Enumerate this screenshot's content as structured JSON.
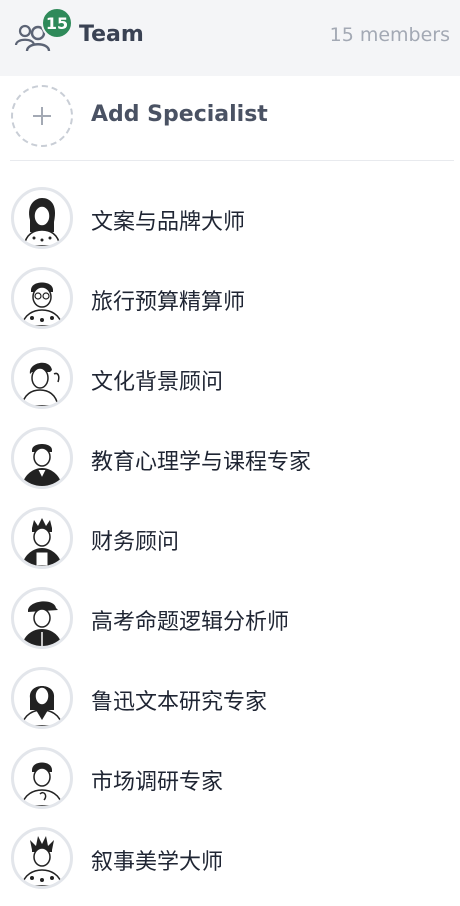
{
  "header": {
    "title": "Team",
    "badge_count": "15",
    "member_count": "15 members",
    "icon": "team-icon"
  },
  "add": {
    "label": "Add Specialist",
    "icon": "plus-icon"
  },
  "specialists": [
    {
      "name": "文案与品牌大师"
    },
    {
      "name": "旅行预算精算师"
    },
    {
      "name": "文化背景顾问"
    },
    {
      "name": "教育心理学与课程专家"
    },
    {
      "name": "财务顾问"
    },
    {
      "name": "高考命题逻辑分析师"
    },
    {
      "name": "鲁迅文本研究专家"
    },
    {
      "name": "市场调研专家"
    },
    {
      "name": "叙事美学大师"
    }
  ],
  "colors": {
    "badge": "#2f8a5a",
    "header_bg": "#f4f5f7",
    "avatar_border": "#e3e6eb"
  }
}
